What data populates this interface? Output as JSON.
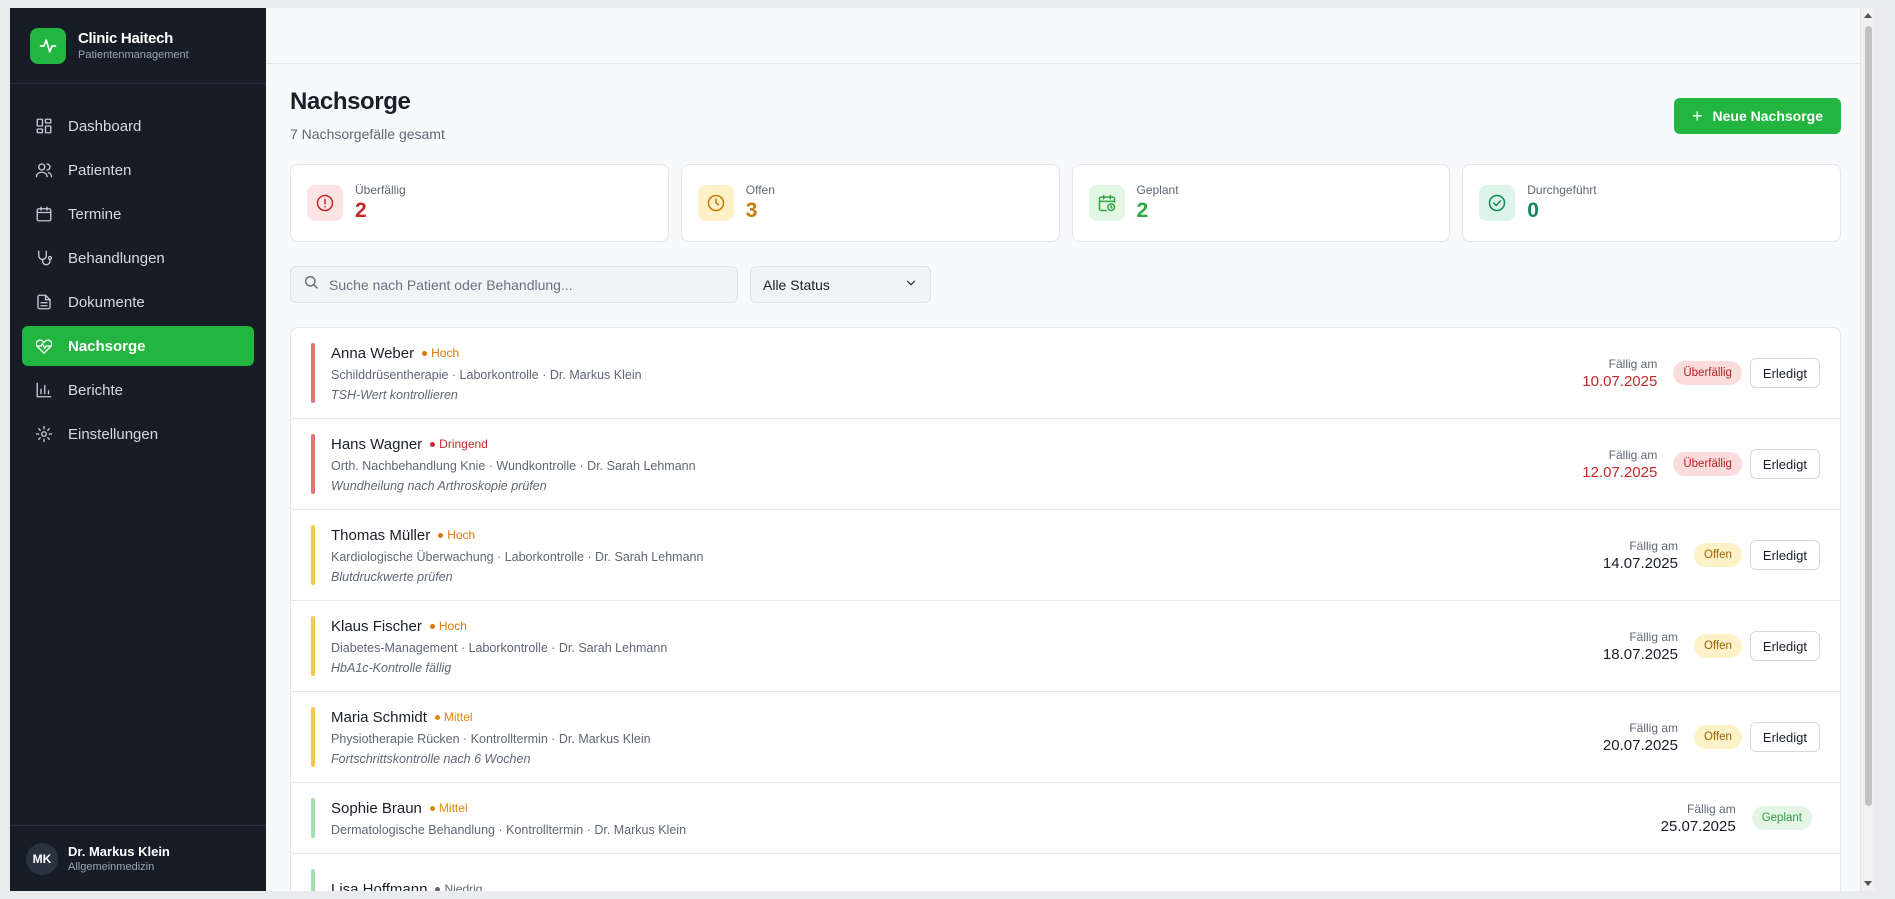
{
  "brand": {
    "title": "Clinic Haitech",
    "subtitle": "Patientenmanagement"
  },
  "nav": [
    {
      "label": "Dashboard",
      "icon": "dashboard-icon",
      "active": false
    },
    {
      "label": "Patienten",
      "icon": "users-icon",
      "active": false
    },
    {
      "label": "Termine",
      "icon": "calendar-icon",
      "active": false
    },
    {
      "label": "Behandlungen",
      "icon": "stethoscope-icon",
      "active": false
    },
    {
      "label": "Dokumente",
      "icon": "document-icon",
      "active": false
    },
    {
      "label": "Nachsorge",
      "icon": "heart-pulse-icon",
      "active": true
    },
    {
      "label": "Berichte",
      "icon": "bar-chart-icon",
      "active": false
    },
    {
      "label": "Einstellungen",
      "icon": "gear-icon",
      "active": false
    }
  ],
  "user": {
    "initials": "MK",
    "name": "Dr. Markus Klein",
    "role": "Allgemeinmedizin"
  },
  "page": {
    "title": "Nachsorge",
    "subtitle": "7 Nachsorgefälle gesamt",
    "new_button": "Neue Nachsorge"
  },
  "stats": [
    {
      "label": "Überfällig",
      "value": "2",
      "color": "#c62828",
      "bg": "#fde4e4",
      "icon": "alert-circle-icon"
    },
    {
      "label": "Offen",
      "value": "3",
      "color": "#c97a06",
      "bg": "#fdf0c7",
      "icon": "clock-icon"
    },
    {
      "label": "Geplant",
      "value": "2",
      "color": "#2fa843",
      "bg": "#e1f6e3",
      "icon": "calendar-clock-icon"
    },
    {
      "label": "Durchgeführt",
      "value": "0",
      "color": "#0f8a5b",
      "bg": "#dcf4ea",
      "icon": "check-circle-icon"
    }
  ],
  "filters": {
    "search_placeholder": "Suche nach Patient oder Behandlung...",
    "status_selected": "Alle Status"
  },
  "due_label": "Fällig am",
  "done_label": "Erledigt",
  "cases": [
    {
      "name": "Anna Weber",
      "priority": "Hoch",
      "prio_color": "#d97706",
      "detail": "Schilddrüsentherapie · Laborkontrolle · Dr. Markus Klein",
      "note": "TSH-Wert kontrollieren",
      "date": "10.07.2025",
      "date_color": "#c62828",
      "status": "Überfällig",
      "status_color": "#b42323",
      "status_bg": "#fbdcdc",
      "bar": "#e57373",
      "done": true
    },
    {
      "name": "Hans Wagner",
      "priority": "Dringend",
      "prio_color": "#c62828",
      "detail": "Orth. Nachbehandlung Knie · Wundkontrolle · Dr. Sarah Lehmann",
      "note": "Wundheilung nach Arthroskopie prüfen",
      "date": "12.07.2025",
      "date_color": "#c62828",
      "status": "Überfällig",
      "status_color": "#b42323",
      "status_bg": "#fbdcdc",
      "bar": "#e57373",
      "done": true
    },
    {
      "name": "Thomas Müller",
      "priority": "Hoch",
      "prio_color": "#d97706",
      "detail": "Kardiologische Überwachung · Laborkontrolle · Dr. Sarah Lehmann",
      "note": "Blutdruckwerte prüfen",
      "date": "14.07.2025",
      "date_color": "#1a1f27",
      "status": "Offen",
      "status_color": "#9a6500",
      "status_bg": "#fdf1c8",
      "bar": "#f2c94c",
      "done": true
    },
    {
      "name": "Klaus Fischer",
      "priority": "Hoch",
      "prio_color": "#d97706",
      "detail": "Diabetes-Management · Laborkontrolle · Dr. Sarah Lehmann",
      "note": "HbA1c-Kontrolle fällig",
      "date": "18.07.2025",
      "date_color": "#1a1f27",
      "status": "Offen",
      "status_color": "#9a6500",
      "status_bg": "#fdf1c8",
      "bar": "#f2c94c",
      "done": true
    },
    {
      "name": "Maria Schmidt",
      "priority": "Mittel",
      "prio_color": "#d98a06",
      "detail": "Physiotherapie Rücken · Kontrolltermin · Dr. Markus Klein",
      "note": "Fortschrittskontrolle nach 6 Wochen",
      "date": "20.07.2025",
      "date_color": "#1a1f27",
      "status": "Offen",
      "status_color": "#9a6500",
      "status_bg": "#fdf1c8",
      "bar": "#f2c94c",
      "done": true
    },
    {
      "name": "Sophie Braun",
      "priority": "Mittel",
      "prio_color": "#d98a06",
      "detail": "Dermatologische Behandlung · Kontrolltermin · Dr. Markus Klein",
      "note": "",
      "date": "25.07.2025",
      "date_color": "#1a1f27",
      "status": "Geplant",
      "status_color": "#2f9a43",
      "status_bg": "#e3f6e5",
      "bar": "#a6dfae",
      "done": false
    },
    {
      "name": "Lisa Hoffmann",
      "priority": "Niedrig",
      "prio_color": "#5f6773",
      "detail": "",
      "note": "",
      "date": "",
      "date_color": "#1a1f27",
      "status": "",
      "status_color": "#2f9a43",
      "status_bg": "#e3f6e5",
      "bar": "#a6dfae",
      "done": false
    }
  ]
}
